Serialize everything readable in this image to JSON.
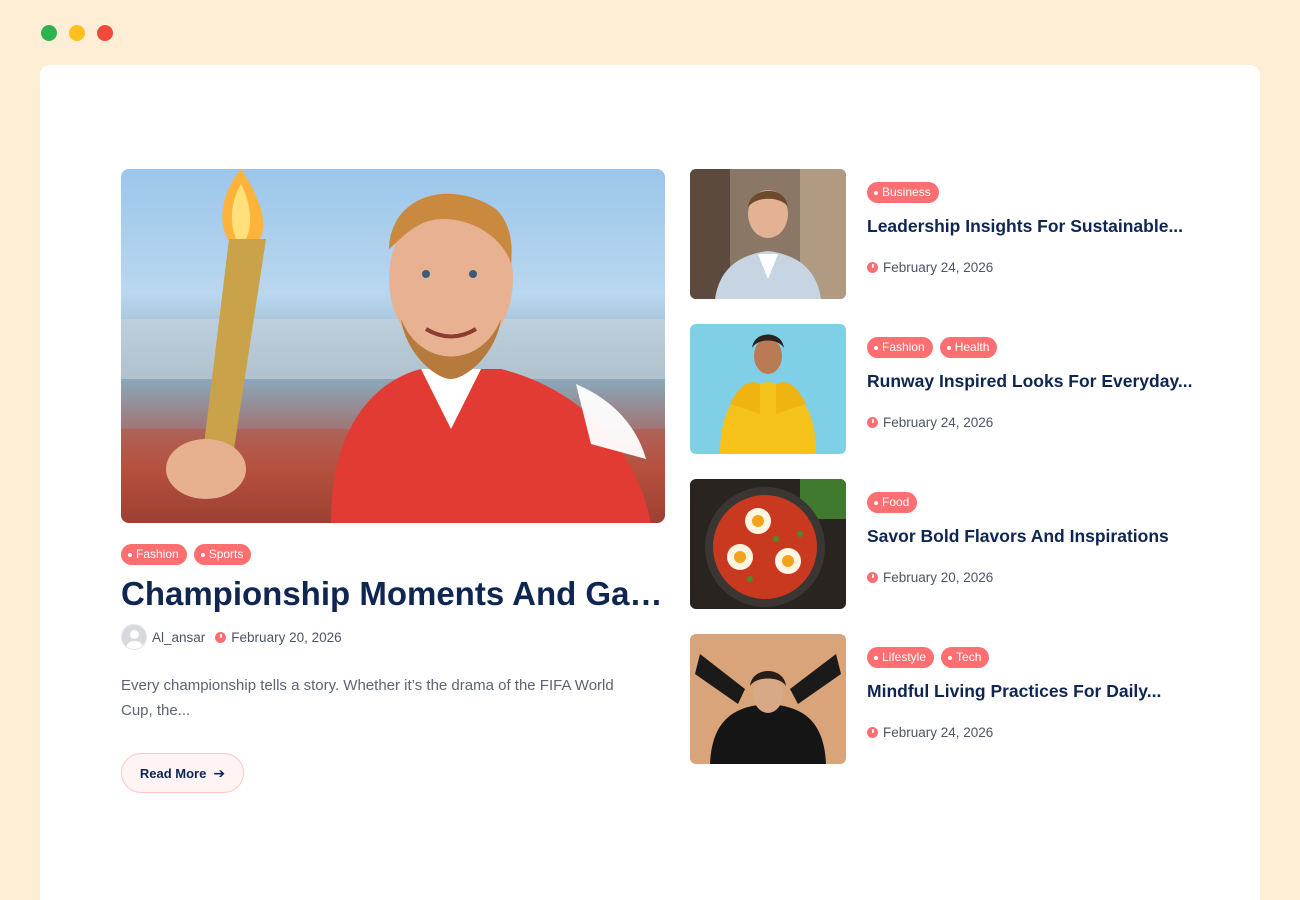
{
  "window": {
    "dots": [
      "#2fb350",
      "#ffbf1f",
      "#ef4b3b"
    ]
  },
  "featured": {
    "tags": [
      "Fashion",
      "Sports"
    ],
    "title": "Championship Moments And Gam...",
    "author": "Al_ansar",
    "date": "February 20, 2026",
    "excerpt": "Every championship tells a story. Whether it’s the drama of the FIFA World Cup, the...",
    "read_more": "Read More",
    "image_icon": "torch-bearer-photo"
  },
  "posts": [
    {
      "tags": [
        "Business"
      ],
      "title": "Leadership Insights For Sustainable...",
      "date": "February 24, 2026",
      "image": "businessman-photo"
    },
    {
      "tags": [
        "Fashion",
        "Health"
      ],
      "title": "Runway Inspired Looks For Everyday...",
      "date": "February 24, 2026",
      "image": "yellow-hoodie-photo"
    },
    {
      "tags": [
        "Food"
      ],
      "title": "Savor Bold Flavors And Inspirations",
      "date": "February 20, 2026",
      "image": "shakshuka-photo"
    },
    {
      "tags": [
        "Lifestyle",
        "Tech"
      ],
      "title": "Mindful Living Practices For Daily...",
      "date": "February 24, 2026",
      "image": "woman-black-outfit-photo"
    }
  ],
  "colors": {
    "accent": "#ff6e70",
    "title": "#0e2651",
    "background": "#ffeed6"
  }
}
